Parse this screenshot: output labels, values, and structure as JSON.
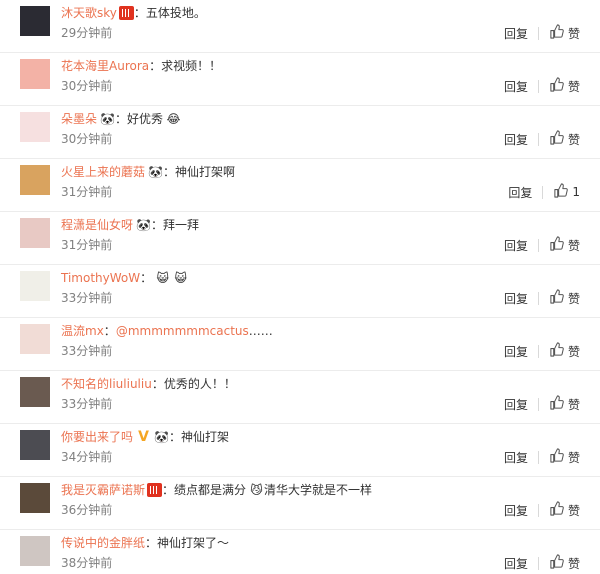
{
  "reply_label": "回复",
  "like_label": "赞",
  "comments": [
    {
      "user": "沐天歌sky",
      "badge": true,
      "text": "：五体投地。",
      "time": "29分钟前",
      "like": "赞",
      "avatar": "#2b2b33"
    },
    {
      "user": "花本海里Aurora",
      "text": "：求视频！！",
      "time": "30分钟前",
      "like": "赞",
      "avatar": "#f3b2a6"
    },
    {
      "user": "朵墨朵",
      "emo1": "🐼",
      "text": "：好优秀",
      "emo2": "😂",
      "time": "30分钟前",
      "like": "赞",
      "avatar": "#f6e0e0"
    },
    {
      "user": "火星上来的蘑菇",
      "emo1": "🐼",
      "text": "：神仙打架啊",
      "time": "31分钟前",
      "like": "1",
      "avatar": "#d9a35f"
    },
    {
      "user": "程潇是仙女呀",
      "emo1": "🐼",
      "text": "：拜一拜",
      "time": "31分钟前",
      "like": "赞",
      "avatar": "#e8c9c4"
    },
    {
      "user": "TimothyWoW",
      "colon_first": true,
      "text": "：",
      "emo2": "😺",
      "emo3": "😺",
      "time": "33分钟前",
      "like": "赞",
      "avatar": "#f0efe8"
    },
    {
      "user": "温流mx",
      "text": "：",
      "mention": "@mmmmmmmcactus",
      "tail": " ……",
      "time": "33分钟前",
      "like": "赞",
      "avatar": "#f1dcd6"
    },
    {
      "user": "不知名的liuliuliu",
      "text": "：优秀的人！！",
      "time": "33分钟前",
      "like": "赞",
      "avatar": "#6a5a50"
    },
    {
      "user": "你要出来了吗",
      "emo1": "V",
      "emo1b": "🐼",
      "text": "：神仙打架",
      "time": "34分钟前",
      "like": "赞",
      "avatar": "#4c4c52"
    },
    {
      "user": "我是灭霸萨诺斯",
      "badge": true,
      "text": "：绩点都是满分",
      "emo2": "😼",
      "text2": "清华大学就是不一样",
      "time": "36分钟前",
      "like": "赞",
      "avatar": "#5b4a3a"
    },
    {
      "user": "传说中的金胖纸",
      "text": "：神仙打架了～",
      "time": "38分钟前",
      "like": "赞",
      "avatar": "#cfc6c2"
    }
  ]
}
